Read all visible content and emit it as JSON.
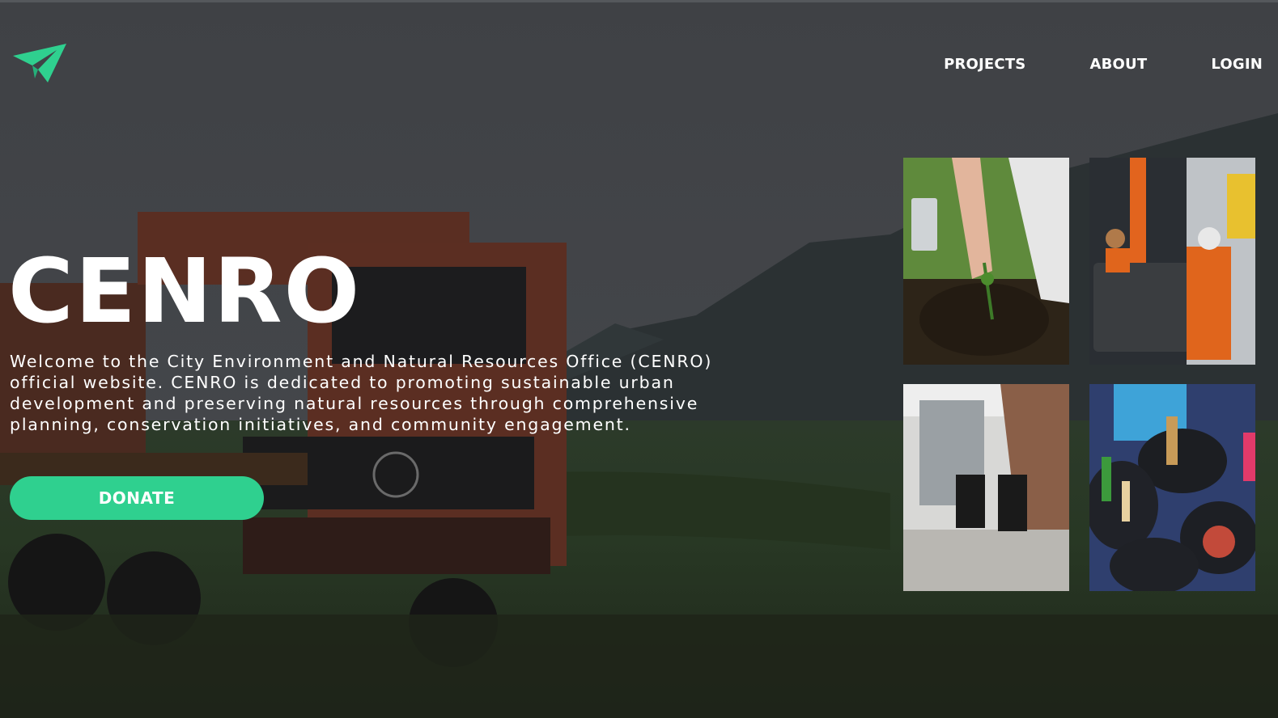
{
  "brand": {
    "logo_icon": "paper-plane-icon",
    "accent": "#2fd08f"
  },
  "nav": {
    "items": [
      {
        "label": "PROJECTS"
      },
      {
        "label": "ABOUT"
      },
      {
        "label": "LOGIN"
      }
    ]
  },
  "hero": {
    "title": "CENRO",
    "description": "Welcome to the City Environment and Natural Resources Office (CENRO) official website. CENRO is dedicated to promoting sustainable urban development and preserving natural resources through comprehensive planning, conservation initiatives, and community engagement.",
    "donate_label": "DONATE"
  },
  "gallery": {
    "images": [
      {
        "subject": "hand planting a seedling"
      },
      {
        "subject": "workers emptying a garbage bin into a truck"
      },
      {
        "subject": "Refuse and Recycle bins beside a brick wall"
      },
      {
        "subject": "buckets of sorted recyclable bottles and cans"
      }
    ]
  }
}
